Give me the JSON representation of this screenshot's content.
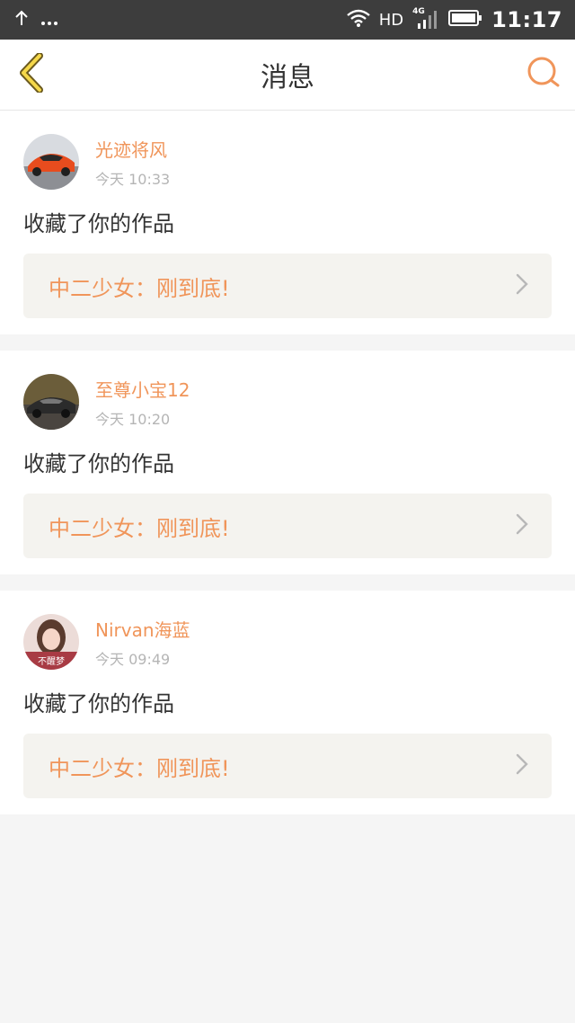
{
  "status_bar": {
    "network": "HD",
    "signal_gen": "4G",
    "time": "11:17"
  },
  "header": {
    "title": "消息"
  },
  "messages": [
    {
      "user": "光迹将风",
      "time": "今天 10:33",
      "action": "收藏了你的作品",
      "work_title": "中二少女：刚到底!",
      "avatar": "red-sports-car"
    },
    {
      "user": "至尊小宝12",
      "time": "今天 10:20",
      "action": "收藏了你的作品",
      "work_title": "中二少女：刚到底!",
      "avatar": "dark-sports-car"
    },
    {
      "user": "Nirvan海蓝",
      "time": "今天 09:49",
      "action": "收藏了你的作品",
      "work_title": "中二少女：刚到底!",
      "avatar": "girl-portrait",
      "avatar_caption": "不醒梦"
    }
  ],
  "colors": {
    "accent": "#f0955a",
    "status_bar_bg": "#3d3d3d",
    "card_link_bg": "#f4f3ef",
    "page_bg": "#f5f5f5"
  }
}
